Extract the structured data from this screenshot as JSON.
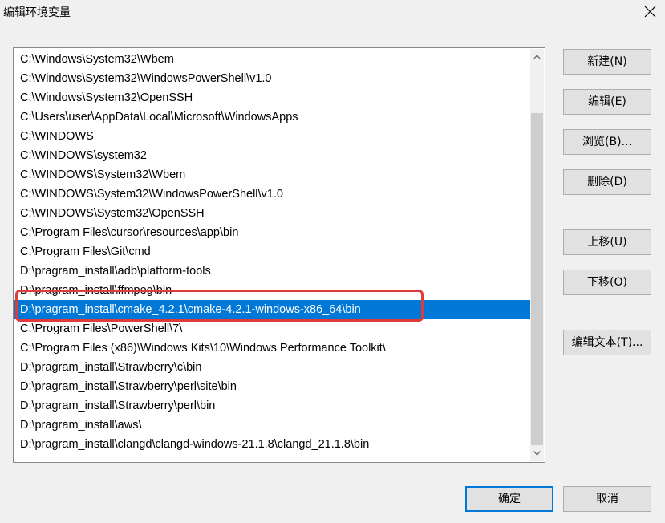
{
  "window": {
    "title": "编辑环境变量"
  },
  "paths": [
    "C:\\Windows\\System32\\Wbem",
    "C:\\Windows\\System32\\WindowsPowerShell\\v1.0",
    "C:\\Windows\\System32\\OpenSSH",
    "C:\\Users\\user\\AppData\\Local\\Microsoft\\WindowsApps",
    "C:\\WINDOWS",
    "C:\\WINDOWS\\system32",
    "C:\\WINDOWS\\System32\\Wbem",
    "C:\\WINDOWS\\System32\\WindowsPowerShell\\v1.0",
    "C:\\WINDOWS\\System32\\OpenSSH",
    "C:\\Program Files\\cursor\\resources\\app\\bin",
    "C:\\Program Files\\Git\\cmd",
    "D:\\pragram_install\\adb\\platform-tools",
    "D:\\pragram_install\\ffmpeg\\bin",
    "D:\\pragram_install\\cmake_4.2.1\\cmake-4.2.1-windows-x86_64\\bin",
    "C:\\Program Files\\PowerShell\\7\\",
    "C:\\Program Files (x86)\\Windows Kits\\10\\Windows Performance Toolkit\\",
    "D:\\pragram_install\\Strawberry\\c\\bin",
    "D:\\pragram_install\\Strawberry\\perl\\site\\bin",
    "D:\\pragram_install\\Strawberry\\perl\\bin",
    "D:\\pragram_install\\aws\\",
    "D:\\pragram_install\\clangd\\clangd-windows-21.1.8\\clangd_21.1.8\\bin"
  ],
  "selected_index": 13,
  "side_buttons": {
    "new": "新建(N)",
    "edit": "编辑(E)",
    "browse": "浏览(B)...",
    "delete": "删除(D)",
    "move_up": "上移(U)",
    "move_down": "下移(O)",
    "edit_text": "编辑文本(T)..."
  },
  "footer": {
    "ok": "确定",
    "cancel": "取消"
  },
  "colors": {
    "selection": "#0078d7",
    "highlight_box": "#e03b3b"
  }
}
